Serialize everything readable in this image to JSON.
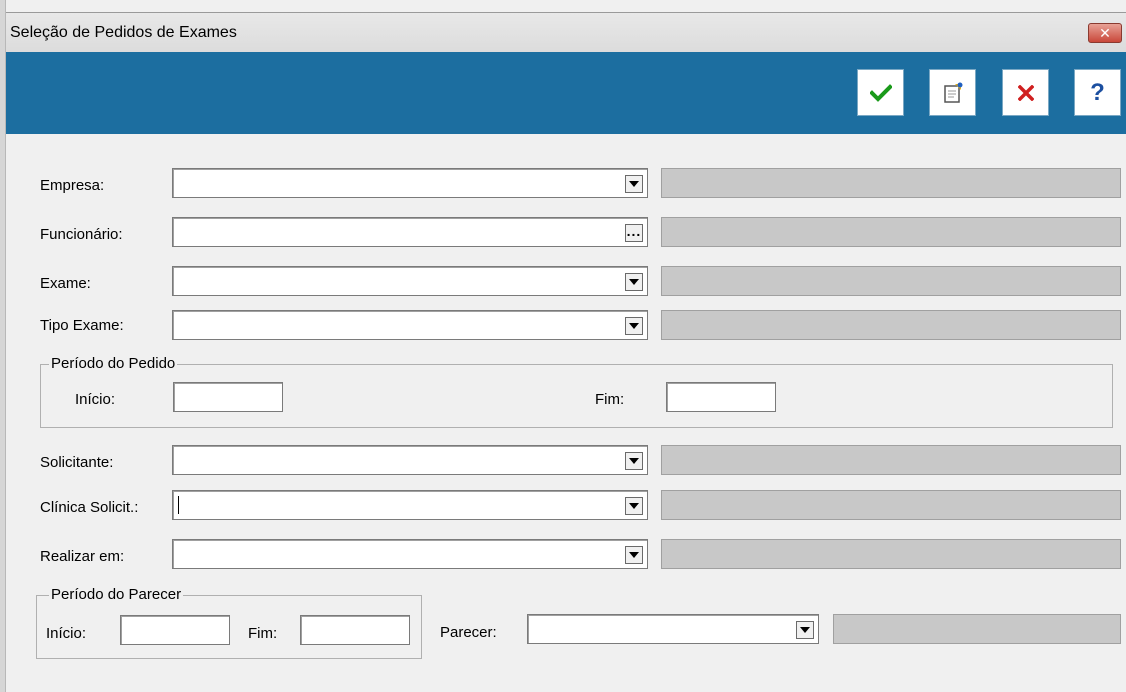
{
  "window": {
    "title": "Seleção de Pedidos de Exames",
    "close_label": "✕"
  },
  "toolbar": {
    "buttons": [
      {
        "name": "confirm",
        "icon": "checkmark-icon",
        "color": "#1a9a1a"
      },
      {
        "name": "notes",
        "icon": "notepad-icon",
        "color": "#e0b020"
      },
      {
        "name": "cancel",
        "icon": "x-icon",
        "color": "#d02020"
      },
      {
        "name": "help",
        "icon": "question-icon",
        "color": "#1c4fa0",
        "label": "?"
      }
    ]
  },
  "form": {
    "empresa": {
      "label": "Empresa:",
      "value": ""
    },
    "funcionario": {
      "label": "Funcionário:",
      "value": "",
      "button_label": "..."
    },
    "exame": {
      "label": "Exame:",
      "value": ""
    },
    "tipo_exame": {
      "label": "Tipo Exame:",
      "value": ""
    },
    "periodo_pedido": {
      "legend": "Período do Pedido",
      "inicio_label": "Início:",
      "inicio_value": "",
      "fim_label": "Fim:",
      "fim_value": ""
    },
    "solicitante": {
      "label": "Solicitante:",
      "value": ""
    },
    "clinica_solicit": {
      "label": "Clínica Solicit.:",
      "value": ""
    },
    "realizar_em": {
      "label": "Realizar em:",
      "value": ""
    },
    "periodo_parecer": {
      "legend": "Período do Parecer",
      "inicio_label": "Início:",
      "inicio_value": "",
      "fim_label": "Fim:",
      "fim_value": ""
    },
    "parecer": {
      "label": "Parecer:",
      "value": ""
    }
  }
}
